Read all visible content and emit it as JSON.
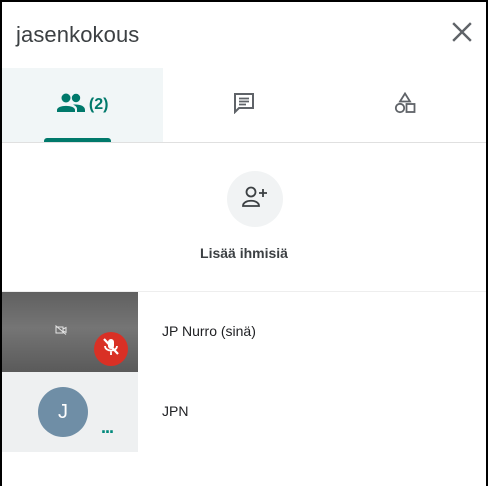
{
  "header": {
    "title": "jasenkokous",
    "close_icon": "close-icon"
  },
  "tabs": [
    {
      "name": "people",
      "icon": "people-icon",
      "label": "(2)",
      "active": true
    },
    {
      "name": "chat",
      "icon": "chat-icon",
      "active": false
    },
    {
      "name": "activities",
      "icon": "shapes-icon",
      "active": false
    }
  ],
  "add_people": {
    "icon": "add-person-icon",
    "label": "Lisää ihmisiä"
  },
  "participants": [
    {
      "name": "JP Nurro (sinä)",
      "muted": true,
      "video": true
    },
    {
      "name": "JPN",
      "avatar_letter": "J",
      "speaking_indicator": "..."
    }
  ],
  "colors": {
    "accent": "#00796b",
    "mic_off": "#d93025",
    "avatar": "#6f8ea6"
  }
}
